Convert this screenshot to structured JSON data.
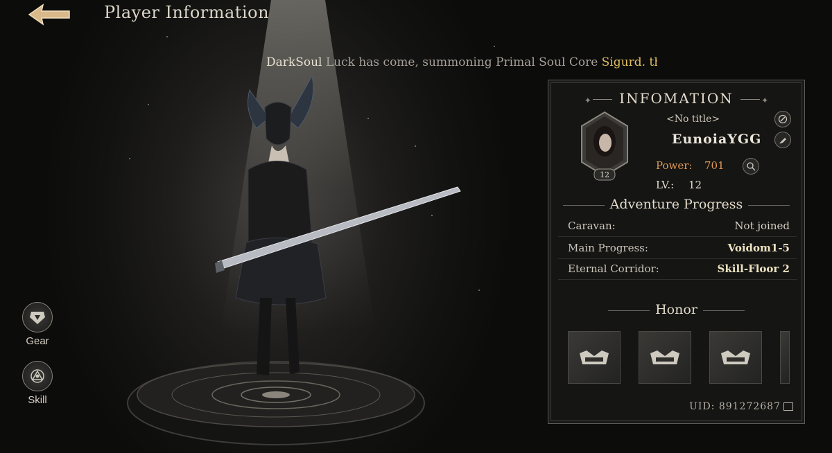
{
  "header": {
    "title": "Player Information",
    "back_icon": "back-arrow-icon"
  },
  "ticker": {
    "player": "DarkSoul",
    "message": " Luck has come, summoning Primal Soul Core ",
    "item": "Sigurd. the I"
  },
  "side_nav": [
    {
      "label": "Gear",
      "icon": "gear-armor-icon"
    },
    {
      "label": "Skill",
      "icon": "skill-constellation-icon"
    }
  ],
  "panel": {
    "title": "INFOMATION",
    "player_title": "<No title>",
    "player_name": "EunoiaYGG",
    "avatar_level": "12",
    "power_label": "Power:",
    "power_value": "701",
    "level_label": "LV.:",
    "level_value": "12",
    "adventure_heading": "Adventure Progress",
    "adventure_rows": [
      {
        "label": "Caravan:",
        "value": "Not joined"
      },
      {
        "label": "Main Progress:",
        "value": "Voidom1-5"
      },
      {
        "label": "Eternal Corridor:",
        "value": "Skill-Floor 2"
      }
    ],
    "honor_heading": "Honor",
    "uid": "UID: 891272687"
  },
  "colors": {
    "accent_gold": "#e3bf62",
    "power_orange": "#e09a55",
    "panel_bg": "#161615"
  }
}
